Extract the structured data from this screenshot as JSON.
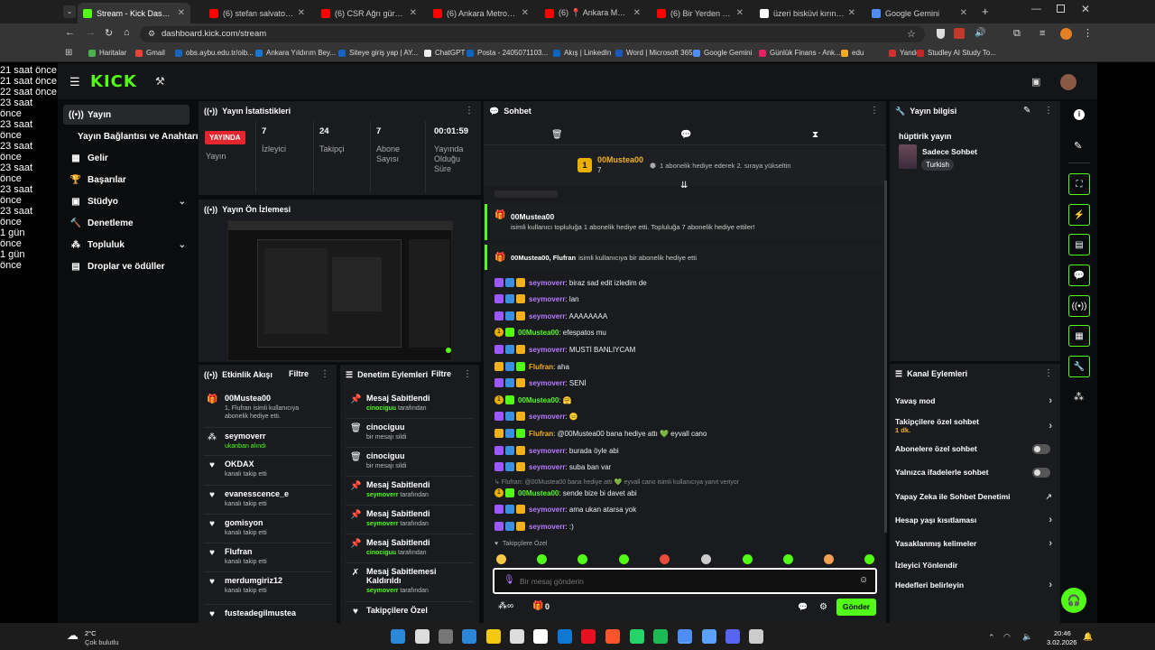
{
  "browser": {
    "tabs": [
      {
        "label": "Stream - Kick Dashboard",
        "active": true,
        "color": "#53fc18"
      },
      {
        "label": "(6) stefan salvatore edit -",
        "color": "#ff0000"
      },
      {
        "label": "(6) CSR Ağrı gürültülü mı",
        "color": "#ff0000"
      },
      {
        "label": "(6) Ankara Metrosunda O",
        "color": "#ff0000"
      },
      {
        "label": "(6) 📍 Ankara Metro #An",
        "color": "#ff0000"
      },
      {
        "label": "(6) Bir Yerden Bir Yere \"A",
        "color": "#ff0000"
      },
      {
        "label": "üzeri bisküvi kırıntılı tatlı",
        "color": "#ffffff"
      },
      {
        "label": "Google Gemini",
        "color": "#4e8df5"
      }
    ],
    "url": "dashboard.kick.com/stream",
    "bookmarks": [
      "Haritalar",
      "Gmail",
      "obs.aybu.edu.tr/oib...",
      "Ankara Yıldırım Bey...",
      "Siteye giriş yap | AY...",
      "ChatGPT",
      "Posta - 2405071103...",
      "Akış | LinkedIn",
      "Word | Microsoft 365",
      "Google Gemini",
      "Günlük Finans - Ank...",
      "edu",
      "Yandex",
      "Studley AI Study To..."
    ]
  },
  "kick": {
    "logo": "KICK",
    "nav": [
      {
        "label": "Yayın",
        "icon": "broadcast-icon"
      },
      {
        "label": "Yayın Bağlantısı ve Anahtarı",
        "icon": ""
      },
      {
        "label": "Gelir",
        "icon": "revenue-icon"
      },
      {
        "label": "Başarılar",
        "icon": "trophy-icon"
      },
      {
        "label": "Stüdyo",
        "icon": "studio-icon"
      },
      {
        "label": "Denetleme",
        "icon": "hammer-icon"
      },
      {
        "label": "Topluluk",
        "icon": "community-icon"
      },
      {
        "label": "Droplar ve ödüller",
        "icon": "gift-icon"
      }
    ],
    "stats": {
      "title": "Yayın İstatistikleri",
      "live_badge": "YAYINDA",
      "stream_label": "Yayın",
      "viewers": {
        "value": "7",
        "label": "İzleyici"
      },
      "followers": {
        "value": "24",
        "label": "Takipçi"
      },
      "subs": {
        "value": "7",
        "label": "Abone Sayısı"
      },
      "uptime": {
        "value": "00:01:59",
        "label": "Yayında Olduğu Süre"
      }
    },
    "preview": {
      "title": "Yayın Ön İzlemesi"
    },
    "activity": {
      "title": "Etkinlik Akışı",
      "filter": "Filtre",
      "items": [
        {
          "name": "00Mustea00",
          "time": "46 saniye önce",
          "sub": "1, Flufran isimli kullanıcıya abonelik hediye etti."
        },
        {
          "name": "seymoverr",
          "time": "19 saat önce",
          "sub": "ukanban alındı"
        },
        {
          "name": "OKDAX",
          "time": "19 saat önce",
          "sub": "kanalı takip etti"
        },
        {
          "name": "evanesscence_e",
          "time": "19 saat önce",
          "sub": "kanalı takip etti"
        },
        {
          "name": "gomisyon",
          "time": "21 saat önce",
          "sub": "kanalı takip etti"
        },
        {
          "name": "Flufran",
          "time": "21 saat önce",
          "sub": "kanalı takip etti"
        },
        {
          "name": "merdumgiriz12",
          "time": "21 saat önce",
          "sub": "kanalı takip etti"
        },
        {
          "name": "fusteadegilmustea",
          "time": "22 saat önce",
          "sub": ""
        }
      ]
    },
    "modlog": {
      "title": "Denetim Eylemleri",
      "filter": "Filtre",
      "items": [
        {
          "title": "Mesaj Sabitlendi",
          "time": "23 saat önce",
          "user": "cinociguu",
          "rest": "tarafından"
        },
        {
          "title": "cinociguu",
          "time": "23 saat önce",
          "user": "",
          "rest": "bir mesajı sildi"
        },
        {
          "title": "cinociguu",
          "time": "23 saat önce",
          "user": "",
          "rest": "bir mesajı sildi"
        },
        {
          "title": "Mesaj Sabitlendi",
          "time": "23 saat önce",
          "user": "seymoverr",
          "rest": "tarafından"
        },
        {
          "title": "Mesaj Sabitlendi",
          "time": "23 saat önce",
          "user": "seymoverr",
          "rest": "tarafından"
        },
        {
          "title": "Mesaj Sabitlendi",
          "time": "23 saat önce",
          "user": "cinociguu",
          "rest": "tarafından"
        },
        {
          "title": "Mesaj Sabitlemesi Kaldırıldı",
          "time": "1 gün önce",
          "user": "seymoverr",
          "rest": "tarafından"
        },
        {
          "title": "Takipçilere Özel",
          "time": "1 gün önce",
          "user": "",
          "rest": ""
        }
      ]
    },
    "chat": {
      "title": "Sohbet",
      "pinned_user": "00Mustea00",
      "pinned_count": "7",
      "pinned_note": "1 abonelik hediye ederek 2. sıraya yükseltin",
      "gift1_user": "00Mustea00",
      "gift1_text": "isimli kullanıcı topluluğa 1 abonelik hediye etti. Topluluğa 7 abonelik hediye ettiler!",
      "gift2_users": "00Mustea00, Flufran",
      "gift2_text": "isimli kullanıcıya bir abonelik hediye etti",
      "messages": [
        {
          "user": "seymoverr",
          "text": ": biraz sad edit izledim de",
          "style": "u1"
        },
        {
          "user": "seymoverr",
          "text": ": lan",
          "style": "u1"
        },
        {
          "user": "seymoverr",
          "text": ": AAAAAAAA",
          "style": "u1"
        },
        {
          "user": "00Mustea00",
          "text": ": efespatos mu",
          "style": "u2"
        },
        {
          "user": "seymoverr",
          "text": ": MUSTİ BANLIYCAM",
          "style": "u1"
        },
        {
          "user": "Flufran",
          "text": ": aha",
          "style": "u3"
        },
        {
          "user": "seymoverr",
          "text": ": SENİ",
          "style": "u1"
        },
        {
          "user": "00Mustea00",
          "text": ": 🤗",
          "style": "u2"
        },
        {
          "user": "seymoverr",
          "text": ": 😐",
          "style": "u1"
        },
        {
          "user": "Flufran",
          "text": ": @00Mustea00 bana hediye attı 💚 eyvall cano",
          "style": "u3"
        },
        {
          "user": "seymoverr",
          "text": ": burada öyle abi",
          "style": "u1"
        },
        {
          "user": "seymoverr",
          "text": ": suba ban var",
          "style": "u1"
        },
        {
          "user": "00Mustea00",
          "text": ": sende bize bi davet abi",
          "style": "u2"
        },
        {
          "user": "seymoverr",
          "text": ": ama ukan atarsa yok",
          "style": "u1"
        },
        {
          "user": "seymoverr",
          "text": ": :)",
          "style": "u1"
        }
      ],
      "reply_note": "↳ Flufran: @00Mustea00 bana hediye attı 💚 eyvall cano isimli kullanıcıya yanıt veriyor",
      "followers_only": "Takipçilere Özel",
      "placeholder": "Bir mesaj gönderin",
      "points": "0",
      "send": "Gönder"
    },
    "info": {
      "title": "Yayın bilgisi",
      "stream_title": "hüptirik yayın",
      "category": "Sadece Sohbet",
      "tag": "Turkish"
    },
    "channel_actions": {
      "title": "Kanal Eylemleri",
      "items": [
        {
          "label": "Yavaş mod",
          "sub": ""
        },
        {
          "label": "Takipçilere özel sohbet",
          "sub": "1 dk."
        },
        {
          "label": "Abonelere özel sohbet",
          "sub": ""
        },
        {
          "label": "Yalnızca ifadelerle sohbet",
          "sub": ""
        },
        {
          "label": "Yapay Zeka ile Sohbet Denetimi",
          "sub": ""
        },
        {
          "label": "Hesap yaşı kısıtlaması",
          "sub": ""
        },
        {
          "label": "Yasaklanmış kelimeler",
          "sub": ""
        },
        {
          "label": "İzleyici Yönlendir",
          "sub": ""
        },
        {
          "label": "Hedefleri belirleyin",
          "sub": ""
        }
      ]
    }
  },
  "taskbar": {
    "weather_temp": "2°C",
    "weather_desc": "Çok bulutlu",
    "time": "20:46",
    "date": "3.02.2026"
  }
}
